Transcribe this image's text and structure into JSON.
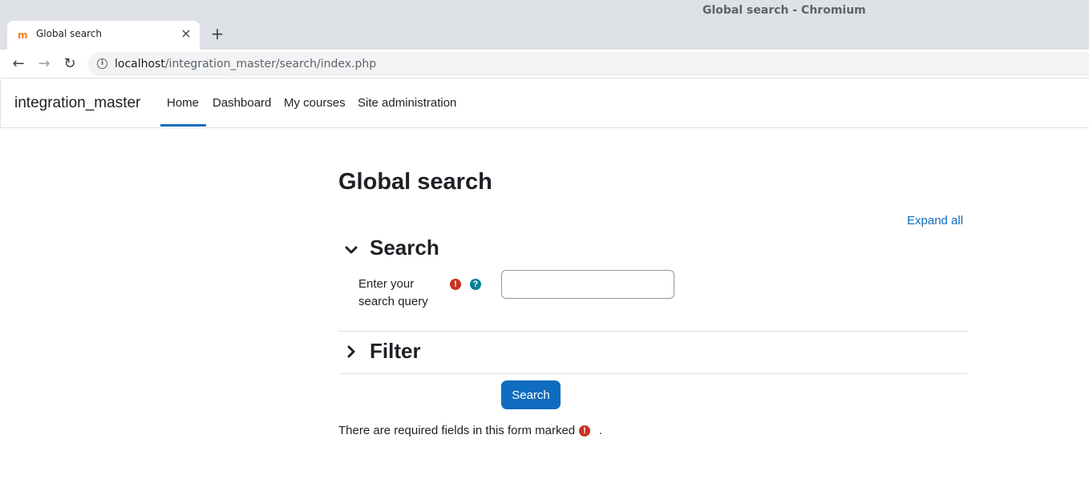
{
  "browser": {
    "window_title": "Global search - Chromium",
    "tab_title": "Global search",
    "url_host": "localhost",
    "url_path": "/integration_master/search/index.php"
  },
  "navbar": {
    "brand": "integration_master",
    "items": [
      {
        "label": "Home"
      },
      {
        "label": "Dashboard"
      },
      {
        "label": "My courses"
      },
      {
        "label": "Site administration"
      }
    ]
  },
  "page": {
    "title": "Global search",
    "expand_all": "Expand all",
    "search_section": "Search",
    "query_label_line1": "Enter your",
    "query_label_line2": "search query",
    "query_value": "",
    "filter_section": "Filter",
    "submit_label": "Search",
    "required_note": "There are required fields in this form marked",
    "required_note_end": "."
  },
  "icons": {
    "required": "exclamation-circle-icon",
    "help": "question-circle-icon"
  },
  "colors": {
    "primary": "#0f6cbf",
    "required": "#ca3120",
    "help": "#008196"
  }
}
